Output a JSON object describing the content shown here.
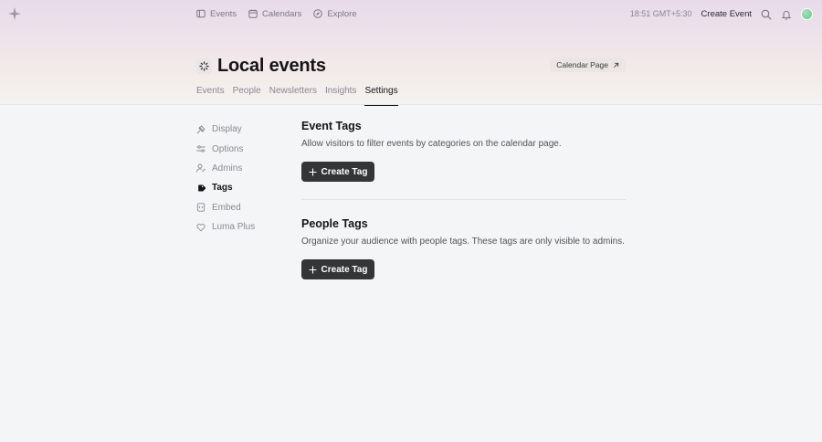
{
  "nav": {
    "links": [
      {
        "label": "Events",
        "icon": "ticket-icon"
      },
      {
        "label": "Calendars",
        "icon": "calendar-icon"
      },
      {
        "label": "Explore",
        "icon": "compass-icon"
      }
    ],
    "time": "18:51 GMT+5:30",
    "create_event": "Create Event"
  },
  "calendar": {
    "title": "Local events",
    "page_button": "Calendar Page"
  },
  "tabs": [
    {
      "label": "Events",
      "active": false
    },
    {
      "label": "People",
      "active": false
    },
    {
      "label": "Newsletters",
      "active": false
    },
    {
      "label": "Insights",
      "active": false
    },
    {
      "label": "Settings",
      "active": true
    }
  ],
  "sidebar": {
    "items": [
      {
        "label": "Display",
        "icon": "palette-icon"
      },
      {
        "label": "Options",
        "icon": "sliders-icon"
      },
      {
        "label": "Admins",
        "icon": "user-edit-icon"
      },
      {
        "label": "Tags",
        "icon": "tag-icon",
        "active": true
      },
      {
        "label": "Embed",
        "icon": "embed-icon"
      },
      {
        "label": "Luma Plus",
        "icon": "heart-icon"
      }
    ]
  },
  "event_tags": {
    "title": "Event Tags",
    "description": "Allow visitors to filter events by categories on the calendar page.",
    "button": "Create Tag"
  },
  "people_tags": {
    "title": "People Tags",
    "description": "Organize your audience with people tags. These tags are only visible to admins.",
    "button": "Create Tag"
  }
}
